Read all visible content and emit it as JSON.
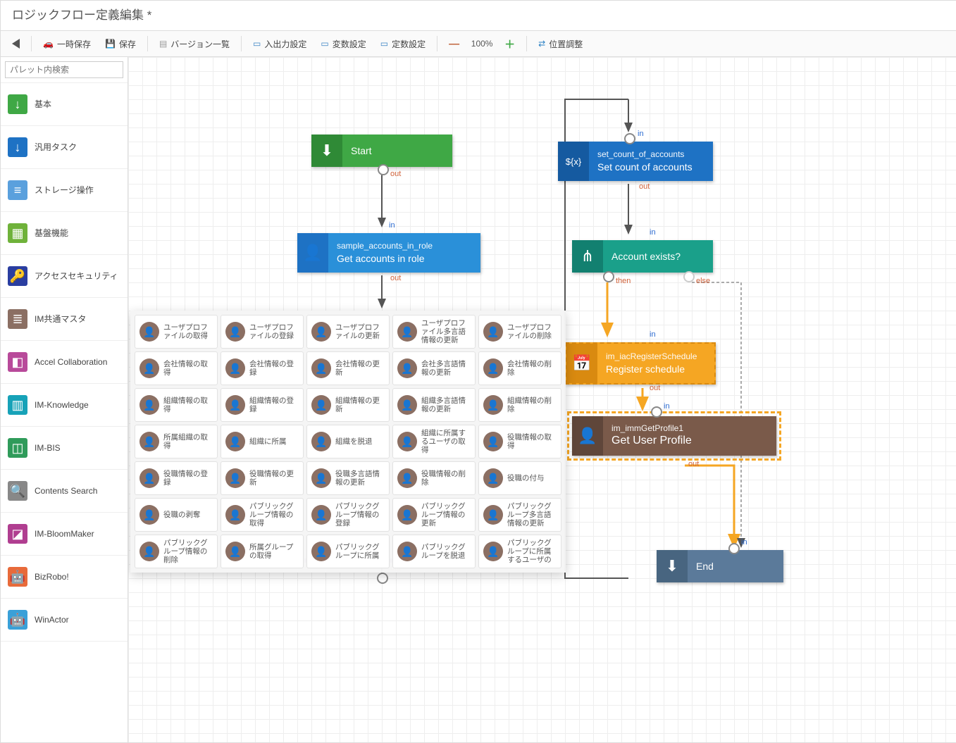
{
  "window_title": "ロジックフロー定義編集  *",
  "toolbar": {
    "temp_save": "一時保存",
    "save": "保存",
    "versions": "バージョン一覧",
    "io_settings": "入出力設定",
    "var_settings": "変数設定",
    "const_settings": "定数設定",
    "zoom": "100%",
    "align": "位置調整"
  },
  "search_placeholder": "パレット内検索",
  "palette": [
    {
      "label": "基本",
      "ico": "↓",
      "bg": "#3fa845"
    },
    {
      "label": "汎用タスク",
      "ico": "↓",
      "bg": "#1e72c4"
    },
    {
      "label": "ストレージ操作",
      "ico": "≡",
      "bg": "#5aa0dd"
    },
    {
      "label": "基盤機能",
      "ico": "▦",
      "bg": "#6fb23a"
    },
    {
      "label": "アクセスセキュリティ",
      "ico": "🔑",
      "bg": "#2a3ea0"
    },
    {
      "label": "IM共通マスタ",
      "ico": "≣",
      "bg": "#8b6f63"
    },
    {
      "label": "Accel Collaboration",
      "ico": "◧",
      "bg": "#b84a9a"
    },
    {
      "label": "IM-Knowledge",
      "ico": "▥",
      "bg": "#17a2b8"
    },
    {
      "label": "IM-BIS",
      "ico": "◫",
      "bg": "#2f9b5a"
    },
    {
      "label": "Contents Search",
      "ico": "🔍",
      "bg": "#888"
    },
    {
      "label": "IM-BloomMaker",
      "ico": "◪",
      "bg": "#b03e90"
    },
    {
      "label": "BizRobo!",
      "ico": "🤖",
      "bg": "#e86a3a"
    },
    {
      "label": "WinActor",
      "ico": "🤖",
      "bg": "#3aa0d8"
    }
  ],
  "nodes": {
    "start": {
      "title": "Start"
    },
    "sample": {
      "key": "sample_accounts_in_role",
      "title": "Get accounts in role"
    },
    "setcount": {
      "key": "set_count_of_accounts",
      "title": "Set count of accounts"
    },
    "exists": {
      "title": "Account exists?"
    },
    "register": {
      "key": "im_iacRegisterSchedule",
      "title": "Register schedule"
    },
    "profile": {
      "key": "im_immGetProfile1",
      "title": "Get User Profile"
    },
    "end": {
      "title": "End"
    }
  },
  "port_labels": {
    "in": "in",
    "out": "out",
    "then": "then",
    "else": "else"
  },
  "popup_items": [
    "ユーザプロファイルの取得",
    "ユーザプロファイルの登録",
    "ユーザプロファイルの更新",
    "ユーザプロファイル多言語情報の更新",
    "ユーザプロファイルの削除",
    "会社情報の取得",
    "会社情報の登録",
    "会社情報の更新",
    "会社多言語情報の更新",
    "会社情報の削除",
    "組織情報の取得",
    "組織情報の登録",
    "組織情報の更新",
    "組織多言語情報の更新",
    "組織情報の削除",
    "所属組織の取得",
    "組織に所属",
    "組織を脱退",
    "組織に所属するユーザの取得",
    "役職情報の取得",
    "役職情報の登録",
    "役職情報の更新",
    "役職多言語情報の更新",
    "役職情報の削除",
    "役職の付与",
    "役職の剥奪",
    "パブリックグループ情報の取得",
    "パブリックグループ情報の登録",
    "パブリックグループ情報の更新",
    "パブリックグループ多言語情報の更新",
    "パブリックグループ情報の削除",
    "所属グループの取得",
    "パブリックグループに所属",
    "パブリックグループを脱退",
    "パブリックグループに所属するユーザの"
  ]
}
